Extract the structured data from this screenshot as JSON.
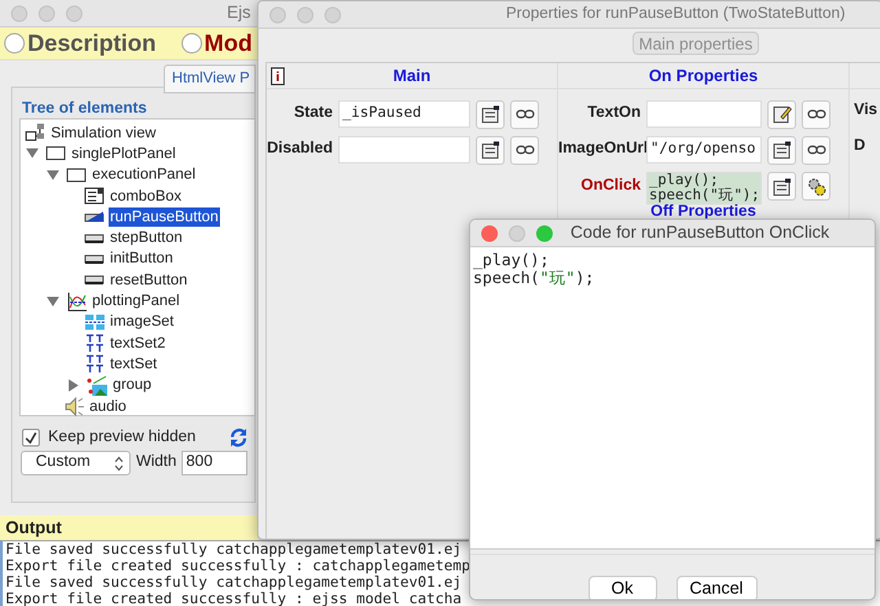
{
  "main_window": {
    "title": "Ejs",
    "tabs": [
      {
        "label": "Description",
        "selected": false
      },
      {
        "label": "Mod",
        "selected": true
      }
    ],
    "view_tab": "HtmlView P",
    "tree": {
      "title": "Tree of elements",
      "items": [
        {
          "label": "Simulation view",
          "kind": "view",
          "selected": false,
          "children": [
            {
              "label": "singlePlotPanel",
              "kind": "panel",
              "selected": false,
              "expanded": true,
              "children": [
                {
                  "label": "executionPanel",
                  "kind": "panel",
                  "selected": false,
                  "expanded": true,
                  "children": [
                    {
                      "label": "comboBox",
                      "kind": "combo",
                      "selected": false
                    },
                    {
                      "label": "runPauseButton",
                      "kind": "two_state_button",
                      "selected": true
                    },
                    {
                      "label": "stepButton",
                      "kind": "button",
                      "selected": false
                    },
                    {
                      "label": "initButton",
                      "kind": "button",
                      "selected": false
                    },
                    {
                      "label": "resetButton",
                      "kind": "button",
                      "selected": false
                    }
                  ]
                },
                {
                  "label": "plottingPanel",
                  "kind": "plot",
                  "selected": false,
                  "expanded": true,
                  "children": [
                    {
                      "label": "imageSet",
                      "kind": "image_set",
                      "selected": false
                    },
                    {
                      "label": "textSet2",
                      "kind": "text_set",
                      "selected": false
                    },
                    {
                      "label": "textSet",
                      "kind": "text_set",
                      "selected": false
                    },
                    {
                      "label": "group",
                      "kind": "group",
                      "selected": false,
                      "expanded": false
                    }
                  ]
                },
                {
                  "label": "audio",
                  "kind": "audio",
                  "selected": false
                }
              ]
            }
          ]
        }
      ]
    },
    "keep_preview_hidden": {
      "label": "Keep preview hidden",
      "checked": true
    },
    "size_select": {
      "value": "Custom"
    },
    "width": {
      "label": "Width",
      "value": "800"
    },
    "output": {
      "title": "Output",
      "lines": [
        "File saved successfully catchapplegametemplatev01.ej",
        "Export file created successfully : catchapplegametemp",
        "File saved successfully catchapplegametemplatev01.ej",
        "Export file created successfully : ejss_model_catcha"
      ]
    }
  },
  "properties_window": {
    "title": "Properties for runPauseButton (TwoStateButton)",
    "main_properties_button": {
      "label": "Main properties",
      "disabled": true
    },
    "columns": [
      {
        "title": "Main",
        "fields": [
          {
            "label": "State",
            "kind": "variable",
            "value": "_isPaused"
          },
          {
            "label": "Disabled",
            "kind": "variable"
          }
        ]
      },
      {
        "title": "On Properties",
        "fields": [
          {
            "label": "TextOn",
            "kind": "text"
          },
          {
            "label": "ImageOnUrl",
            "kind": "variable",
            "value": "\"/org/openso"
          },
          {
            "label": "OnClick",
            "kind": "code",
            "lines": [
              "_play();",
              "speech(\"玩\");"
            ]
          }
        ],
        "subtitle": "Off Properties"
      },
      {
        "fields": [
          {
            "label": "Vis",
            "kind": "cut"
          },
          {
            "label": "D",
            "kind": "cut"
          }
        ]
      }
    ]
  },
  "code_dialog": {
    "title": "Code for runPauseButton OnClick",
    "lines": [
      {
        "segments": [
          {
            "text": "_play();",
            "kind": "plain"
          }
        ]
      },
      {
        "segments": [
          {
            "text": "speech(",
            "kind": "plain"
          },
          {
            "text": "\"玩\"",
            "kind": "string"
          },
          {
            "text": ");",
            "kind": "plain"
          }
        ]
      }
    ],
    "buttons": [
      "Ok",
      "Cancel"
    ]
  }
}
